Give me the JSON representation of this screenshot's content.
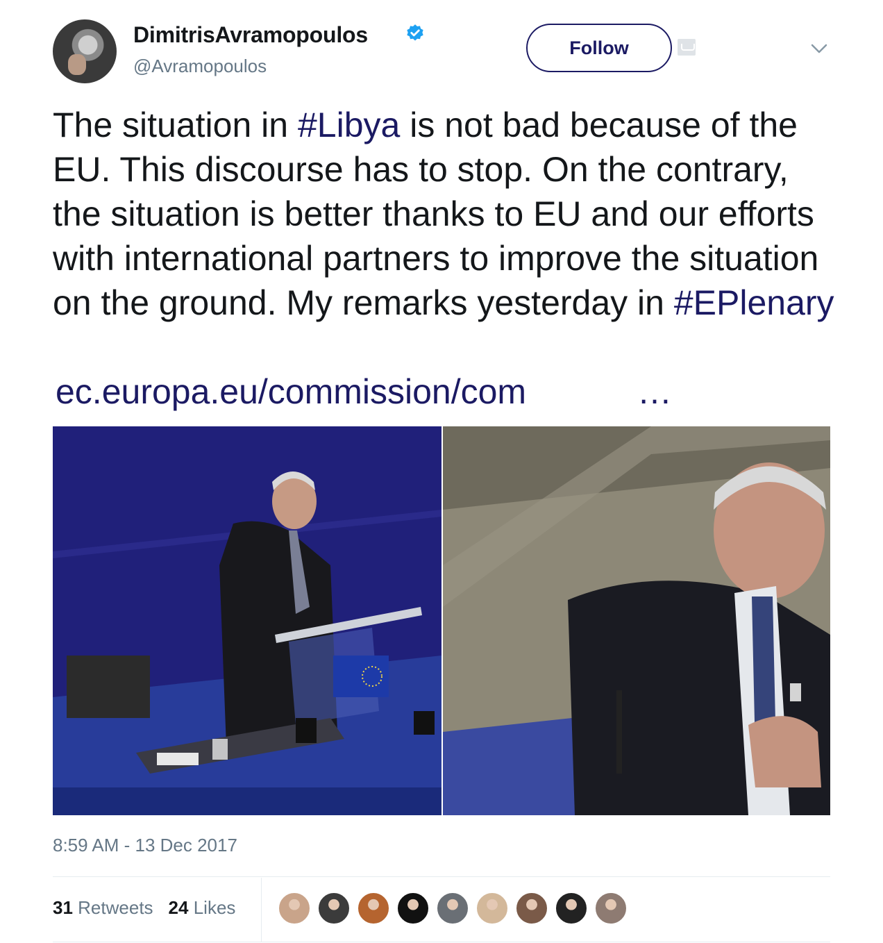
{
  "user": {
    "display_name": "DimitrisAvramopoulos",
    "handle": "@Avramopoulos"
  },
  "header": {
    "follow_label": "Follow"
  },
  "tweet": {
    "text_part1": "The situation in ",
    "hashtag1": "#Libya",
    "text_part2": " is not bad because of the EU. This discourse has to stop. On the contrary, the situation is better thanks to EU and our efforts with international partners to improve the situation on the ground. My remarks yesterday in ",
    "hashtag2": "#EPlenary",
    "link": "ec.europa.eu/commission/com",
    "ellipsis": "…"
  },
  "timestamp": "8:59 AM - 13 Dec 2017",
  "stats": {
    "retweets_count": "31",
    "retweets_label": "Retweets",
    "likes_count": "24",
    "likes_label": "Likes"
  },
  "liker_avatars": [
    {
      "name": "liker-avatar-1",
      "color": "#c9a48a"
    },
    {
      "name": "liker-avatar-2",
      "color": "#3b3b3b"
    },
    {
      "name": "liker-avatar-3",
      "color": "#b5642f"
    },
    {
      "name": "liker-avatar-4",
      "color": "#111111"
    },
    {
      "name": "liker-avatar-5",
      "color": "#6a6f75"
    },
    {
      "name": "liker-avatar-6",
      "color": "#d3b89a"
    },
    {
      "name": "liker-avatar-7",
      "color": "#7a5a48"
    },
    {
      "name": "liker-avatar-8",
      "color": "#222222"
    },
    {
      "name": "liker-avatar-9",
      "color": "#8e7b72"
    }
  ],
  "colors": {
    "link": "#1b1a63",
    "muted": "#657786",
    "verified": "#1da1f2"
  }
}
